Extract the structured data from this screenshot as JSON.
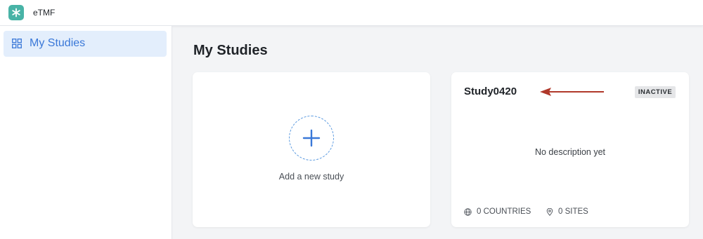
{
  "app": {
    "title": "eTMF",
    "logo_icon": "asterisk-logo-icon",
    "brand_color": "#48b3a6"
  },
  "sidebar": {
    "items": [
      {
        "label": "My Studies",
        "icon": "grid-icon",
        "active": true
      }
    ]
  },
  "main": {
    "title": "My Studies",
    "add_card": {
      "label": "Add a new study",
      "icon": "plus-icon"
    },
    "studies": [
      {
        "name": "Study0420",
        "status": "INACTIVE",
        "description": "No description yet",
        "countries": "0 COUNTRIES",
        "sites": "0 SITES"
      }
    ]
  },
  "colors": {
    "accent": "#3a78d8",
    "annotation_arrow": "#b0382a"
  }
}
